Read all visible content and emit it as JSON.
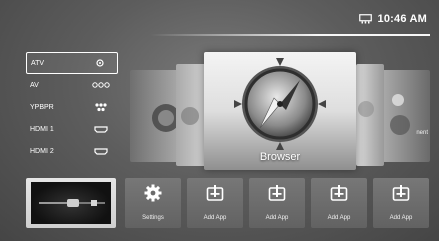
{
  "status": {
    "time": "10:46 AM",
    "network_icon": "network-icon"
  },
  "sources": [
    {
      "label": "ATV",
      "icon": "atv-icon",
      "selected": true
    },
    {
      "label": "AV",
      "icon": "av-icon",
      "selected": false
    },
    {
      "label": "YPBPR",
      "icon": "ypbpr-icon",
      "selected": false
    },
    {
      "label": "HDMI 1",
      "icon": "hdmi-icon",
      "selected": false
    },
    {
      "label": "HDMI 2",
      "icon": "hdmi-icon",
      "selected": false
    }
  ],
  "carousel": {
    "focused_label": "Browser",
    "focused_icon": "compass-icon",
    "right_partial_label": "nent"
  },
  "apps": [
    {
      "label": "Settings",
      "icon": "gear-icon"
    },
    {
      "label": "Add App",
      "icon": "add-app-icon"
    },
    {
      "label": "Add App",
      "icon": "add-app-icon"
    },
    {
      "label": "Add App",
      "icon": "add-app-icon"
    },
    {
      "label": "Add App",
      "icon": "add-app-icon"
    }
  ]
}
